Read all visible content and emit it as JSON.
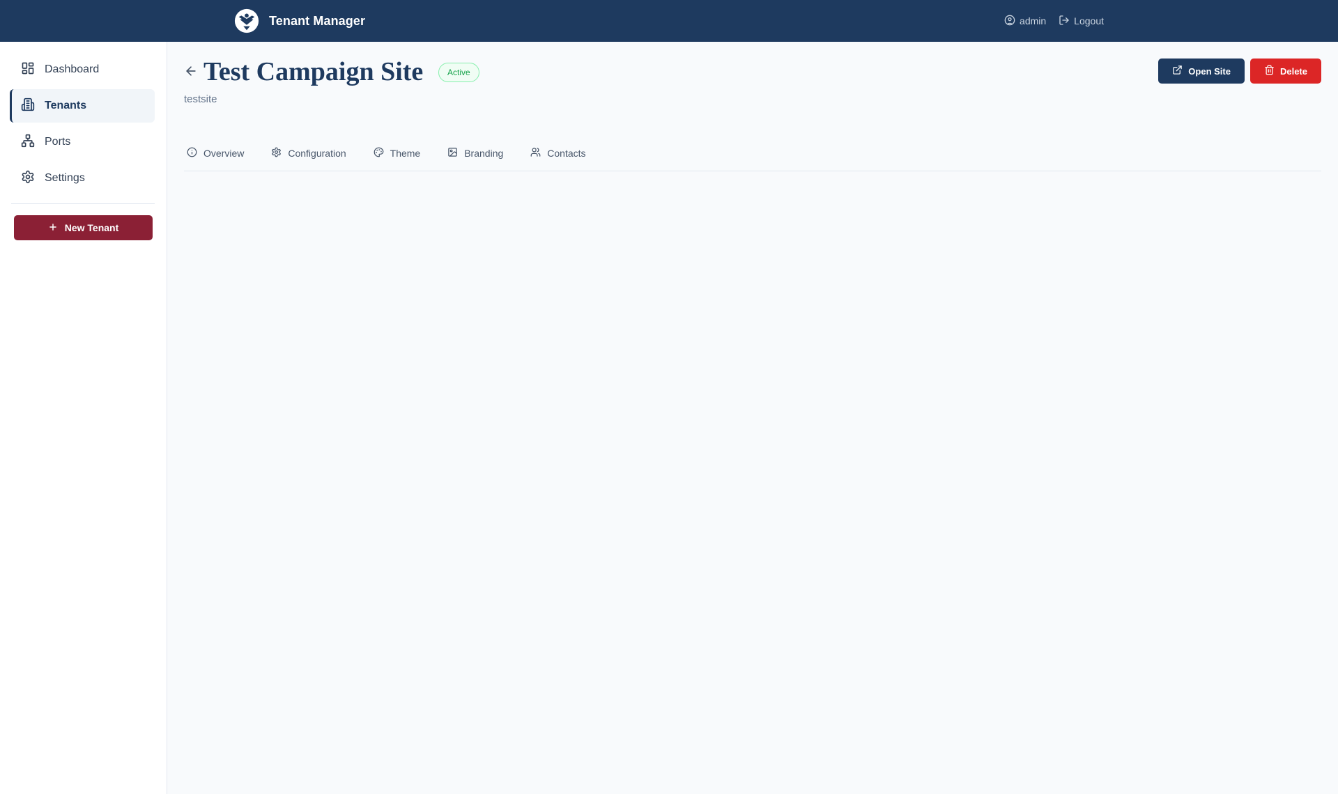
{
  "header": {
    "app_title": "Tenant Manager",
    "logo_icon": "eagle-shield-icon",
    "user": "admin",
    "logout": "Logout"
  },
  "sidebar": {
    "items": [
      {
        "label": "Dashboard",
        "icon": "dashboard-icon",
        "active": false
      },
      {
        "label": "Tenants",
        "icon": "building-icon",
        "active": true
      },
      {
        "label": "Ports",
        "icon": "network-icon",
        "active": false
      },
      {
        "label": "Settings",
        "icon": "gear-icon",
        "active": false
      }
    ],
    "new_tenant_label": "New Tenant"
  },
  "page": {
    "title": "Test Campaign Site",
    "status": "Active",
    "subtitle": "testsite",
    "open_site_label": "Open Site",
    "delete_label": "Delete"
  },
  "tabs": [
    {
      "label": "Overview",
      "icon": "info-icon"
    },
    {
      "label": "Configuration",
      "icon": "gear-icon"
    },
    {
      "label": "Theme",
      "icon": "palette-icon"
    },
    {
      "label": "Branding",
      "icon": "image-icon"
    },
    {
      "label": "Contacts",
      "icon": "users-icon"
    }
  ],
  "colors": {
    "topbar": "#1e3a5f",
    "accent_primary": "#1e3a5f",
    "accent_new_tenant": "#8b2035",
    "danger": "#dc2626",
    "status_active": "#16a34a"
  }
}
